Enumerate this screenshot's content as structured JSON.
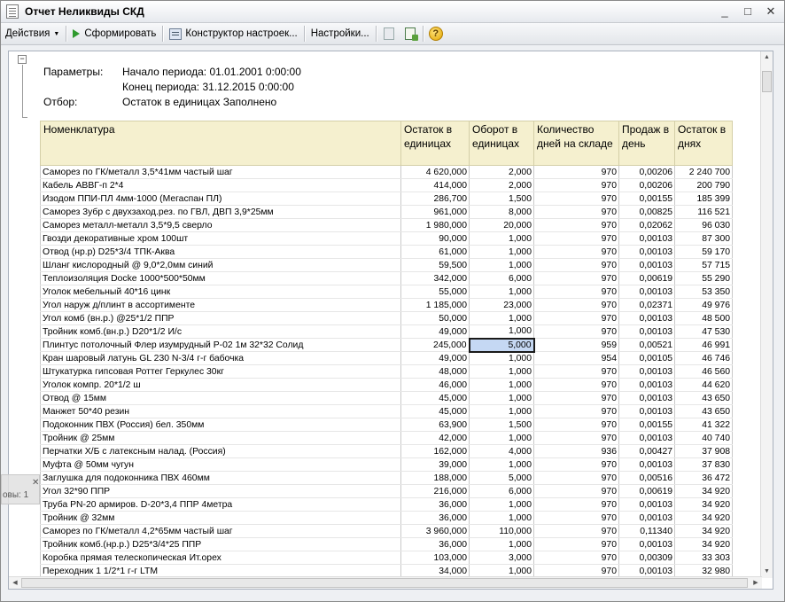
{
  "window": {
    "title": "Отчет  Неликвиды СКД",
    "controls": [
      "_",
      "□",
      "✕"
    ]
  },
  "toolbar": {
    "actions_label": "Действия",
    "generate_label": "Сформировать",
    "constructor_label": "Конструктор настроек...",
    "settings_label": "Настройки...",
    "help_label": "?"
  },
  "params": {
    "title_label": "Параметры:",
    "start_text": "Начало периода: 01.01.2001 0:00:00",
    "end_text": "Конец периода: 31.12.2015 0:00:00",
    "filter_label": "Отбор:",
    "filter_text": "Остаток в единицах Заполнено"
  },
  "table": {
    "headers": [
      "Номенклатура",
      "Остаток в единицах",
      "Оборот в единицах",
      "Количество дней на складе",
      "Продаж в день",
      "Остаток в днях"
    ],
    "rows": [
      [
        "Саморез по ГК/металл 3,5*41мм частый шаг",
        "4 620,000",
        "2,000",
        "970",
        "0,00206",
        "2 240 700"
      ],
      [
        "Кабель АВВГ-п 2*4",
        "414,000",
        "2,000",
        "970",
        "0,00206",
        "200 790"
      ],
      [
        "Изодом ППИ-ПЛ 4мм-1000 (Мегаспан ПЛ)",
        "286,700",
        "1,500",
        "970",
        "0,00155",
        "185 399"
      ],
      [
        "Саморез 3убр с двухзаход.рез. по ГВЛ, ДВП 3,9*25мм",
        "961,000",
        "8,000",
        "970",
        "0,00825",
        "116 521"
      ],
      [
        "Саморез металл-металл 3,5*9,5 сверло",
        "1 980,000",
        "20,000",
        "970",
        "0,02062",
        "96 030"
      ],
      [
        "Гвозди декоративные хром 100шт",
        "90,000",
        "1,000",
        "970",
        "0,00103",
        "87 300"
      ],
      [
        "Отвод (нр.р) D25*3/4 ТПК-Аква",
        "61,000",
        "1,000",
        "970",
        "0,00103",
        "59 170"
      ],
      [
        "Шланг кислородный @ 9,0*2,0мм синий",
        "59,500",
        "1,000",
        "970",
        "0,00103",
        "57 715"
      ],
      [
        "Теплоизоляция Docke 1000*500*50мм",
        "342,000",
        "6,000",
        "970",
        "0,00619",
        "55 290"
      ],
      [
        "Уголок мебельный 40*16 цинк",
        "55,000",
        "1,000",
        "970",
        "0,00103",
        "53 350"
      ],
      [
        "Угол наруж д/плинт в ассортименте",
        "1 185,000",
        "23,000",
        "970",
        "0,02371",
        "49 976"
      ],
      [
        "Угол комб (вн.р.) @25*1/2 ППР",
        "50,000",
        "1,000",
        "970",
        "0,00103",
        "48 500"
      ],
      [
        "Тройник комб.(вн.р.) D20*1/2 И/с",
        "49,000",
        "1,000",
        "970",
        "0,00103",
        "47 530"
      ],
      [
        "Плинтус потолочный Флер изумрудный Р-02 1м 32*32 Солид",
        "245,000",
        "5,000",
        "959",
        "0,00521",
        "46 991"
      ],
      [
        "Кран шаровый латунь GL 230 N-3/4 г-г бабочка",
        "49,000",
        "1,000",
        "954",
        "0,00105",
        "46 746"
      ],
      [
        "Штукатурка гипсовая Роттег Геркулес 30кг",
        "48,000",
        "1,000",
        "970",
        "0,00103",
        "46 560"
      ],
      [
        "Уголок компр. 20*1/2  ш",
        "46,000",
        "1,000",
        "970",
        "0,00103",
        "44 620"
      ],
      [
        "Отвод @ 15мм",
        "45,000",
        "1,000",
        "970",
        "0,00103",
        "43 650"
      ],
      [
        "Манжет 50*40 резин",
        "45,000",
        "1,000",
        "970",
        "0,00103",
        "43 650"
      ],
      [
        "Подоконник ПВХ (Россия) бел. 350мм",
        "63,900",
        "1,500",
        "970",
        "0,00155",
        "41 322"
      ],
      [
        "Тройник @ 25мм",
        "42,000",
        "1,000",
        "970",
        "0,00103",
        "40 740"
      ],
      [
        "Перчатки Х/Б с латексным налад. (Россия)",
        "162,000",
        "4,000",
        "936",
        "0,00427",
        "37 908"
      ],
      [
        "Муфта @ 50мм чугун",
        "39,000",
        "1,000",
        "970",
        "0,00103",
        "37 830"
      ],
      [
        "Заглушка для подоконника ПВХ 460мм",
        "188,000",
        "5,000",
        "970",
        "0,00516",
        "36 472"
      ],
      [
        "Угол 32*90 ППР",
        "216,000",
        "6,000",
        "970",
        "0,00619",
        "34 920"
      ],
      [
        "Труба  PN-20 армиров. D-20*3,4 ППР 4метра",
        "36,000",
        "1,000",
        "970",
        "0,00103",
        "34 920"
      ],
      [
        "Тройник @ 32мм",
        "36,000",
        "1,000",
        "970",
        "0,00103",
        "34 920"
      ],
      [
        "Саморез по ГК/металл 4,2*65мм частый шаг",
        "3 960,000",
        "110,000",
        "970",
        "0,11340",
        "34 920"
      ],
      [
        "Тройник комб.(нр.р.) D25*3/4*25 ППР",
        "36,000",
        "1,000",
        "970",
        "0,00103",
        "34 920"
      ],
      [
        "Коробка прямая телескопическая Ит.орех",
        "103,000",
        "3,000",
        "970",
        "0,00309",
        "33 303"
      ],
      [
        "Переходник 1 1/2*1 г-г LTM",
        "34,000",
        "1,000",
        "970",
        "0,00103",
        "32 980"
      ]
    ]
  },
  "overlay": {
    "text": "овы: 1"
  }
}
